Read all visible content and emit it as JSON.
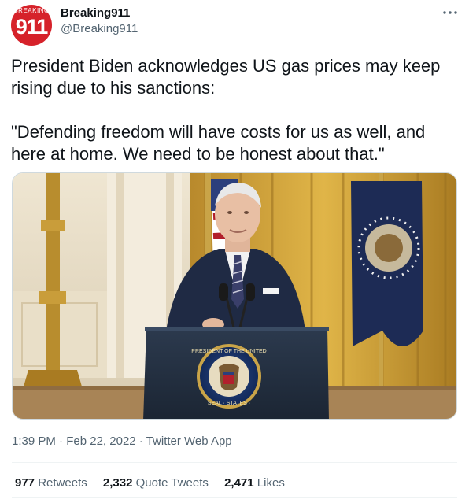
{
  "author": {
    "avatar_ring_text": "BREAKING",
    "avatar_logo_text": "911",
    "display_name": "Breaking911",
    "handle": "@Breaking911"
  },
  "tweet": {
    "text": "President Biden acknowledges US gas prices may keep rising due to his sanctions:\n\n\"Defending freedom will have costs for us as well, and here at home. We need to be honest about that.\""
  },
  "media": {
    "seal_text_top": "PRESIDENT OF THE UNITED",
    "seal_text_bottom": "SEAL · STATES ·"
  },
  "meta": {
    "time": "1:39 PM",
    "date": "Feb 22, 2022",
    "source": "Twitter Web App",
    "separator": "·"
  },
  "stats": {
    "retweets_count": "977",
    "retweets_label": "Retweets",
    "quotes_count": "2,332",
    "quotes_label": "Quote Tweets",
    "likes_count": "2,471",
    "likes_label": "Likes"
  },
  "colors": {
    "accent_red": "#d6222a",
    "text_primary": "#0f1419",
    "text_secondary": "#536471",
    "divider": "#eff3f4"
  },
  "icons": {
    "more": "more-horizontal-icon"
  }
}
